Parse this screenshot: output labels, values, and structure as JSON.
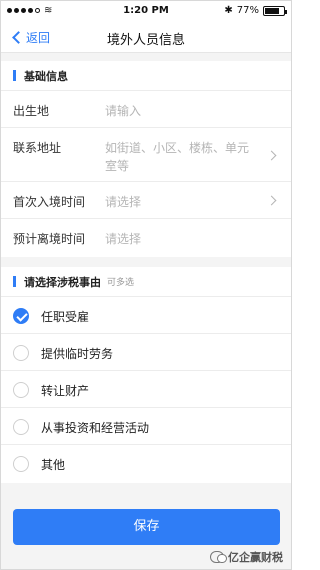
{
  "status_bar": {
    "time": "1:20 PM",
    "battery_percent": "77%",
    "bluetooth_icon": "bluetooth-icon",
    "wifi_icon": "wifi-icon"
  },
  "nav": {
    "back_label": "返回",
    "title": "境外人员信息"
  },
  "basic_info": {
    "title": "基础信息",
    "fields": [
      {
        "label": "出生地",
        "placeholder": "请输入"
      },
      {
        "label": "联系地址",
        "placeholder": "如街道、小区、楼栋、单元室等"
      },
      {
        "label": "首次入境时间",
        "placeholder": "请选择"
      },
      {
        "label": "预计离境时间",
        "placeholder": "请选择"
      }
    ]
  },
  "tax_reason": {
    "title": "请选择涉税事由",
    "hint": "可多选",
    "options": [
      {
        "label": "任职受雇",
        "checked": true
      },
      {
        "label": "提供临时劳务",
        "checked": false
      },
      {
        "label": "转让财产",
        "checked": false
      },
      {
        "label": "从事投资和经营活动",
        "checked": false
      },
      {
        "label": "其他",
        "checked": false
      }
    ]
  },
  "actions": {
    "save_label": "保存"
  },
  "watermark": {
    "text": "亿企赢财税"
  },
  "colors": {
    "accent": "#2f7df6",
    "placeholder": "#b5b5b5",
    "background": "#f4f4f4"
  }
}
